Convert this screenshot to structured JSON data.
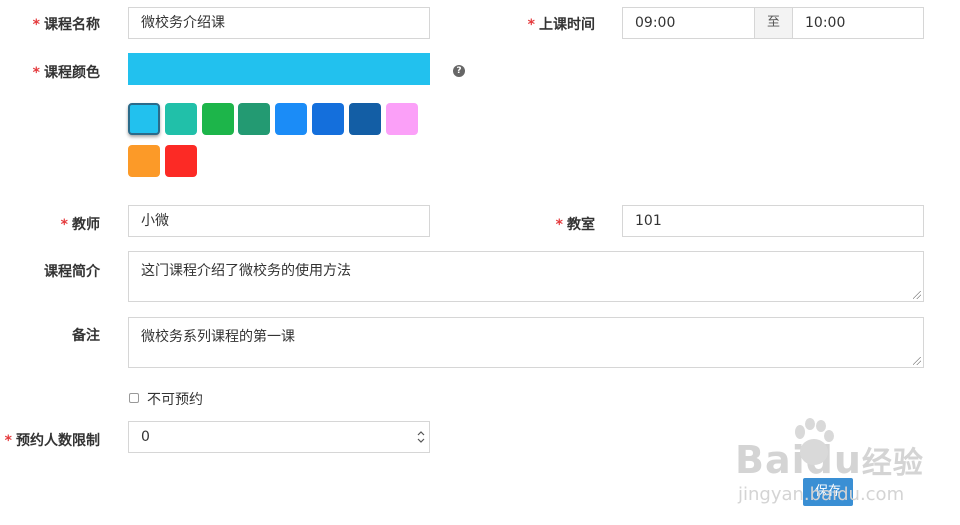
{
  "form": {
    "required_mark": "*",
    "course_name": {
      "label": "课程名称",
      "value": "微校务介绍课"
    },
    "class_time": {
      "label": "上课时间",
      "start": "09:00",
      "separator": "至",
      "end": "10:00"
    },
    "course_color": {
      "label": "课程颜色",
      "value_color": "#22c1ee",
      "help_glyph": "?",
      "swatches": [
        "#22c1ee",
        "#21c0a9",
        "#1db54a",
        "#239a72",
        "#1b8cf7",
        "#146fdc",
        "#135ea5",
        "#fba0f8",
        "#fc9a28",
        "#fc2a25"
      ],
      "selected_index": 0
    },
    "teacher": {
      "label": "教师",
      "value": "小微"
    },
    "classroom": {
      "label": "教室",
      "value": "101"
    },
    "intro": {
      "label": "课程简介",
      "value": "这门课程介绍了微校务的使用方法"
    },
    "remark": {
      "label": "备注",
      "value": "微校务系列课程的第一课"
    },
    "no_booking": {
      "label": "不可预约",
      "checked": false
    },
    "booking_limit": {
      "label": "预约人数限制",
      "value": "0"
    },
    "save_button": {
      "label": "保存"
    }
  },
  "watermark": {
    "brand": "Baidu",
    "brand_cn": "经验",
    "url": "jingyan.baidu.com"
  }
}
